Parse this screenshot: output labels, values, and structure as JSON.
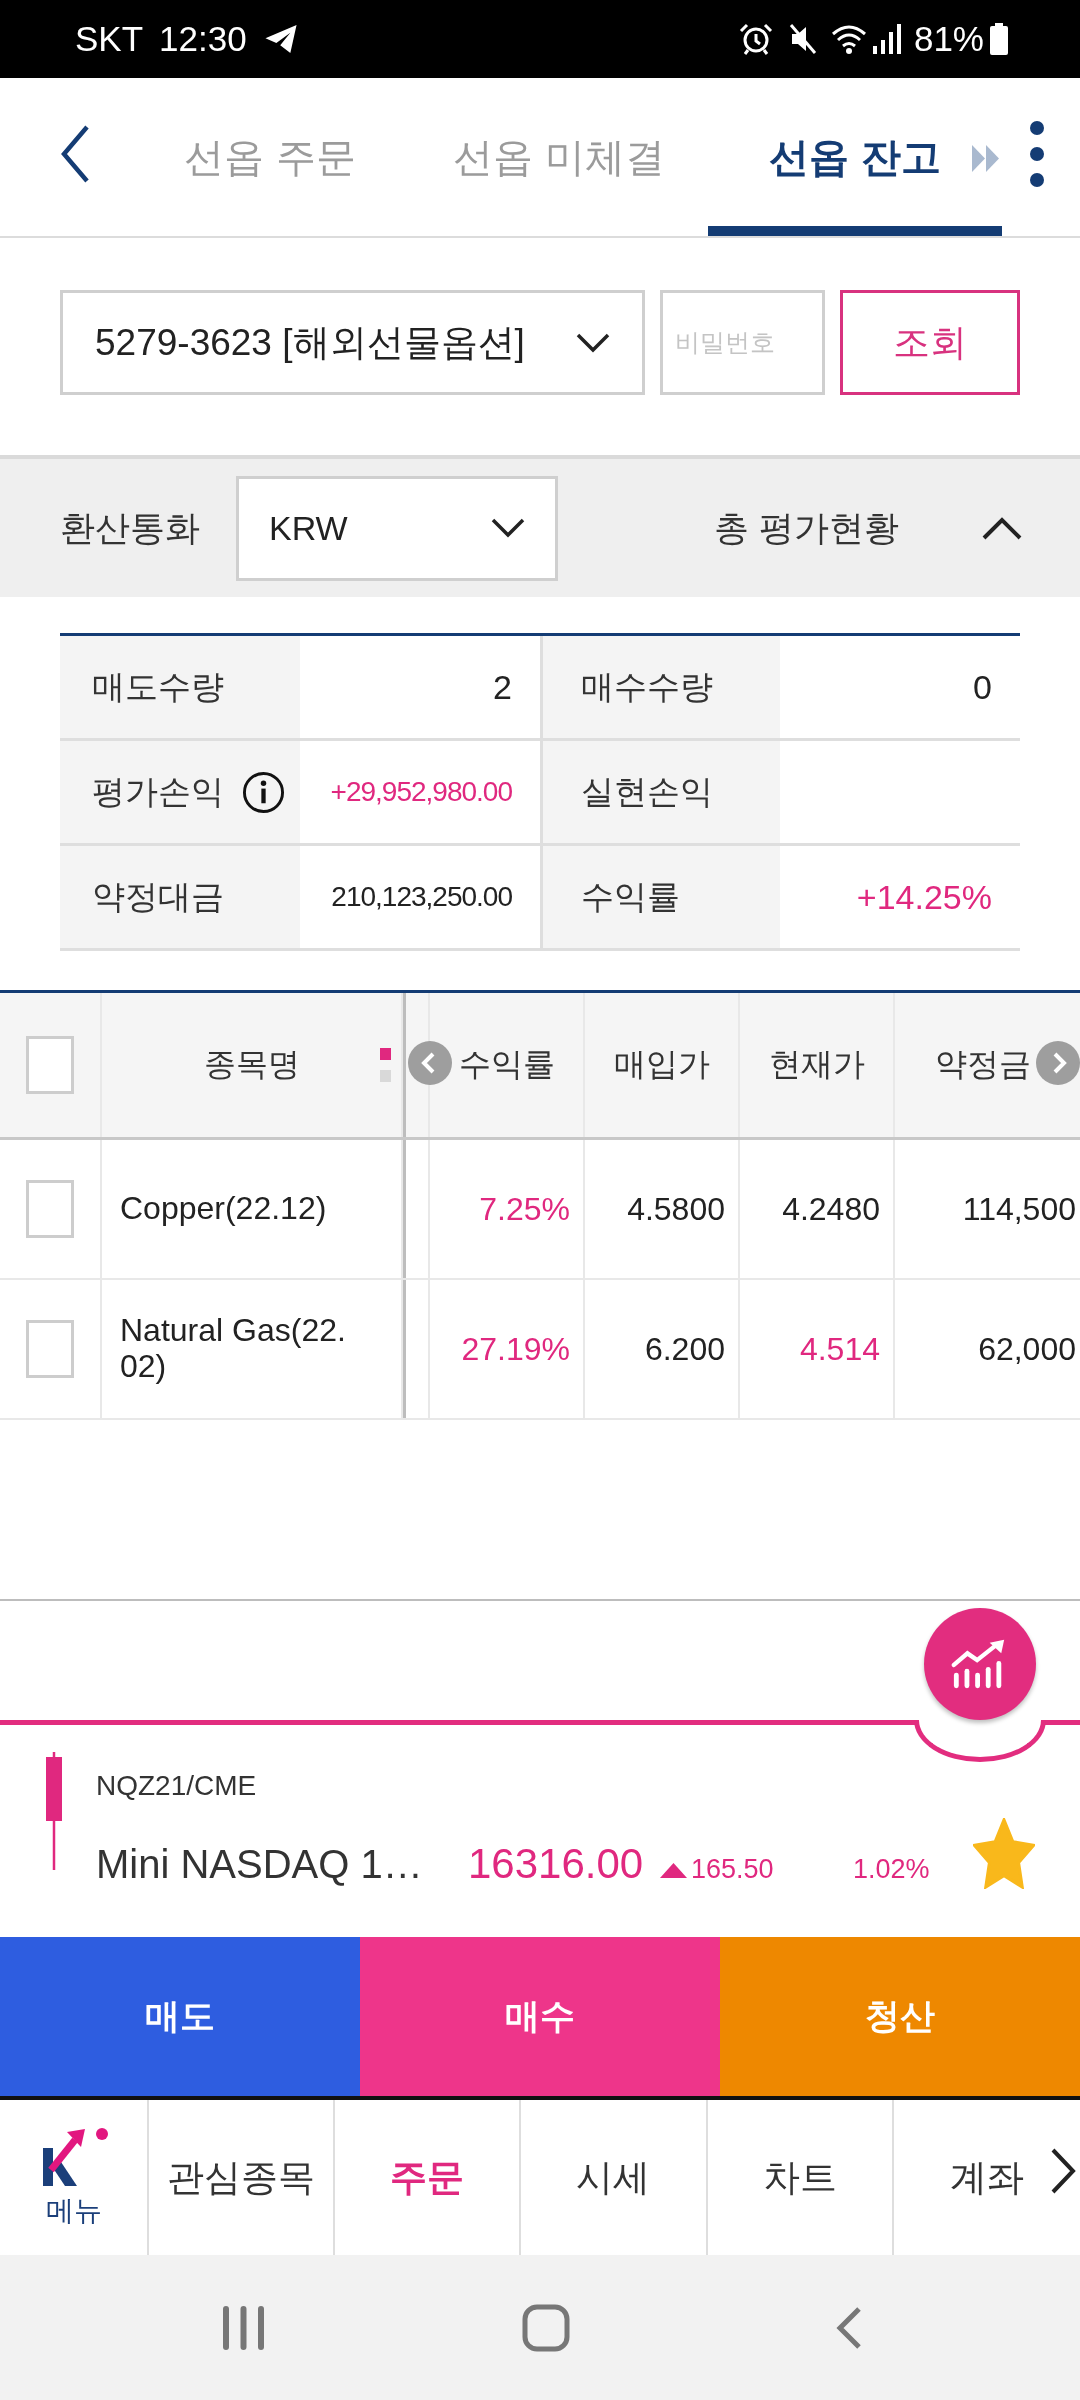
{
  "status_bar": {
    "carrier": "SKT",
    "time": "12:30",
    "battery": "81%"
  },
  "header": {
    "tabs": [
      {
        "label": "선옵 주문",
        "selected": false
      },
      {
        "label": "선옵 미체결",
        "selected": false
      },
      {
        "label": "선옵 잔고",
        "selected": true
      }
    ]
  },
  "account": {
    "value": "5279-3623 [해외선물옵션]",
    "password_placeholder": "비밀번호",
    "search_button": "조회"
  },
  "currency_bar": {
    "label": "환산통화",
    "value": "KRW",
    "summary_title": "총 평가현황",
    "expanded": true
  },
  "summary": [
    {
      "label": "매도수량",
      "value": "2",
      "gain": false,
      "info": false
    },
    {
      "label": "매수수량",
      "value": "0",
      "gain": false,
      "info": false
    },
    {
      "label": "평가손익",
      "value": "+29,952,980.00",
      "gain": true,
      "info": true
    },
    {
      "label": "실현손익",
      "info": false
    },
    {
      "label": "약정대금",
      "value": "210,123,250.00",
      "gain": false,
      "info": false
    },
    {
      "label": "수익률",
      "value": "+14.25%",
      "gain": true,
      "info": false
    }
  ],
  "table": {
    "select_all_checked": false,
    "page_dots": [
      {
        "selected": true
      },
      {
        "selected": false
      }
    ],
    "columns": [
      "종목명",
      "수익률",
      "매입가",
      "현재가",
      "약정금"
    ],
    "rows": [
      {
        "checked": false,
        "cells": [
          {
            "text": "Copper(22.12)"
          },
          {
            "text": "7.25%",
            "gain": true
          },
          {
            "text": "4.5800",
            "gain": false
          },
          {
            "text": "4.2480",
            "gain": false
          },
          {
            "text": "114,500",
            "gain": false
          }
        ]
      },
      {
        "checked": false,
        "cells": [
          {
            "text": "Natural Gas(22.02)"
          },
          {
            "text": "27.19%",
            "gain": true
          },
          {
            "text": "6.200",
            "gain": false
          },
          {
            "text": "4.514",
            "gain": true
          },
          {
            "text": "62,000",
            "gain": false
          }
        ]
      }
    ]
  },
  "ticker": {
    "symbol": "NQZ21/CME",
    "name": "Mini NASDAQ 1…",
    "price": "16316.00",
    "rising": true,
    "change": "165.50",
    "rate": "1.02%",
    "favorite": true
  },
  "actions": [
    {
      "label": "매도",
      "color": "#2e5de0"
    },
    {
      "label": "매수",
      "color": "#ee358a"
    },
    {
      "label": "청산",
      "color": "#ee8800"
    }
  ],
  "nav": {
    "menu_label": "메뉴",
    "items": [
      {
        "label": "관심종목",
        "selected": false
      },
      {
        "label": "주문",
        "selected": true
      },
      {
        "label": "시세",
        "selected": false
      },
      {
        "label": "차트",
        "selected": false
      },
      {
        "label": "계좌",
        "selected": false
      }
    ]
  }
}
